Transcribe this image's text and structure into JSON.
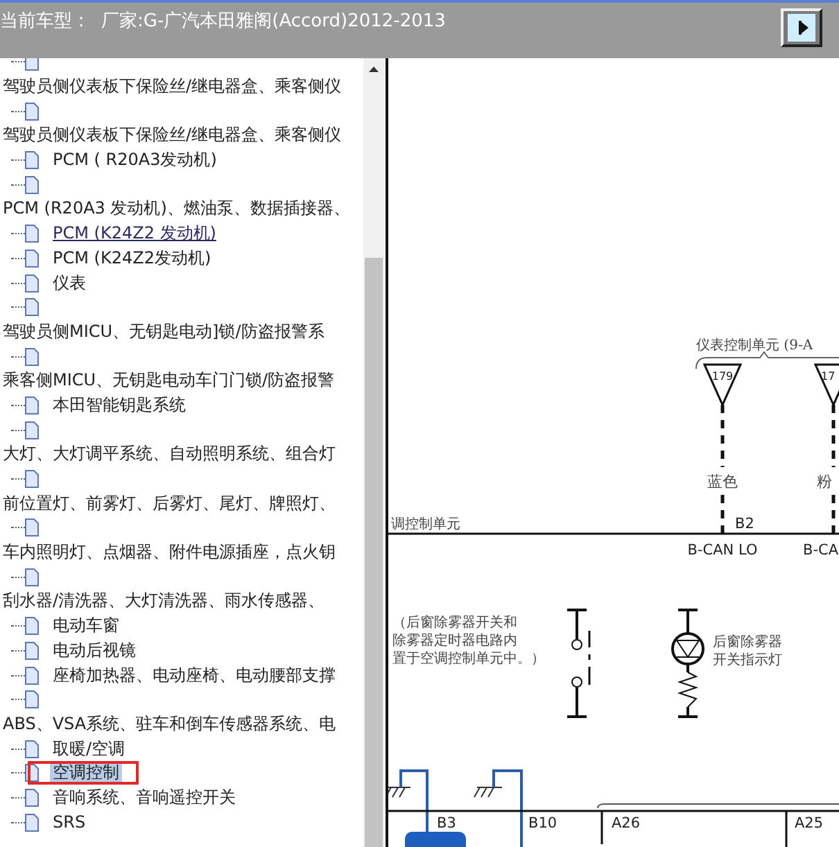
{
  "header": {
    "label": "当前车型：",
    "model": "厂家:G-广汽本田雅阁(Accord)2012-2013"
  },
  "tree": {
    "items": [
      {
        "kind": "wrapped",
        "label": "驾驶员侧仪表板下保险丝/继电器盒、乘客侧仪",
        "selected": false,
        "hovered": false,
        "boxed": false
      },
      {
        "kind": "wrapped",
        "label": "驾驶员侧仪表板下保险丝/继电器盒、乘客侧仪",
        "selected": false,
        "hovered": false,
        "boxed": false
      },
      {
        "kind": "inline",
        "label": "PCM ( R20A3发动机)",
        "selected": false,
        "hovered": false,
        "boxed": false
      },
      {
        "kind": "wrapped",
        "label": "PCM (R20A3 发动机)、燃油泵、数据插接器、",
        "selected": false,
        "hovered": false,
        "boxed": false
      },
      {
        "kind": "inline",
        "label": "PCM (K24Z2 发动机)",
        "selected": false,
        "hovered": true,
        "boxed": false
      },
      {
        "kind": "inline",
        "label": "PCM (K24Z2发动机)",
        "selected": false,
        "hovered": false,
        "boxed": false
      },
      {
        "kind": "inline",
        "label": "仪表",
        "selected": false,
        "hovered": false,
        "boxed": false
      },
      {
        "kind": "wrapped",
        "label": "驾驶员侧MICU、无钥匙电动]锁/防盗报警系",
        "selected": false,
        "hovered": false,
        "boxed": false
      },
      {
        "kind": "wrapped",
        "label": "乘客侧MICU、无钥匙电动车门门锁/防盗报警",
        "selected": false,
        "hovered": false,
        "boxed": false
      },
      {
        "kind": "inline",
        "label": "本田智能钥匙系统",
        "selected": false,
        "hovered": false,
        "boxed": false
      },
      {
        "kind": "wrapped",
        "label": "大灯、大灯调平系统、自动照明系统、组合灯",
        "selected": false,
        "hovered": false,
        "boxed": false
      },
      {
        "kind": "wrapped",
        "label": "前位置灯、前雾灯、后雾灯、尾灯、牌照灯、",
        "selected": false,
        "hovered": false,
        "boxed": false
      },
      {
        "kind": "wrapped",
        "label": "车内照明灯、点烟器、附件电源插座，点火钥",
        "selected": false,
        "hovered": false,
        "boxed": false
      },
      {
        "kind": "wrapped",
        "label": "刮水器/清洗器、大灯清洗器、雨水传感器、",
        "selected": false,
        "hovered": false,
        "boxed": false
      },
      {
        "kind": "inline",
        "label": "电动车窗",
        "selected": false,
        "hovered": false,
        "boxed": false
      },
      {
        "kind": "inline",
        "label": "电动后视镜",
        "selected": false,
        "hovered": false,
        "boxed": false
      },
      {
        "kind": "inline",
        "label": "座椅加热器、电动座椅、电动腰部支撑",
        "selected": false,
        "hovered": false,
        "boxed": false
      },
      {
        "kind": "wrapped",
        "label": "ABS、VSA系统、驻车和倒车传感器系统、电",
        "selected": false,
        "hovered": false,
        "boxed": false
      },
      {
        "kind": "inline",
        "label": "取暖/空调",
        "selected": false,
        "hovered": false,
        "boxed": false
      },
      {
        "kind": "inline",
        "label": "空调控制",
        "selected": true,
        "hovered": false,
        "boxed": true
      },
      {
        "kind": "inline",
        "label": "音响系统、音响遥控开关",
        "selected": false,
        "hovered": false,
        "boxed": false
      },
      {
        "kind": "inline",
        "label": "SRS",
        "selected": false,
        "hovered": false,
        "boxed": false
      }
    ]
  },
  "diagram": {
    "unit_title": "仪表控制单元 (9-A",
    "pins": [
      "179",
      "17"
    ],
    "wire_colors": [
      "蓝色",
      "粉"
    ],
    "module": "调控制单元",
    "terminal": "B2",
    "signals": [
      "B-CAN LO",
      "B-CA"
    ],
    "note": [
      "（后窗除雾器开关和",
      "除雾器定时器电路内",
      "置于空调控制单元中。）"
    ],
    "lamp_label": [
      "后窗除雾器",
      "开关指示灯"
    ],
    "connectors": [
      "B3",
      "B10",
      "A26",
      "A25"
    ]
  }
}
